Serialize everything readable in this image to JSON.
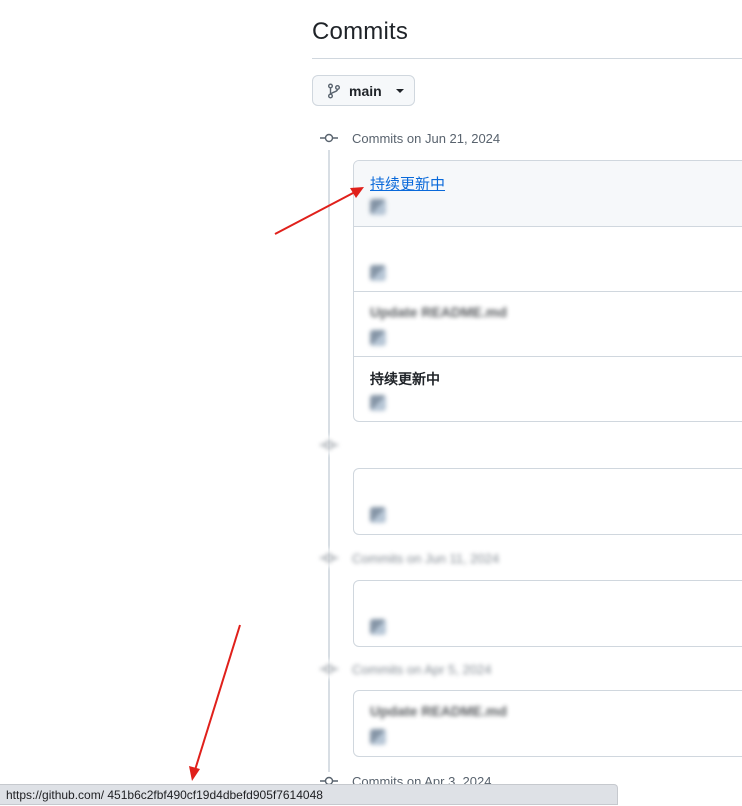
{
  "page": {
    "title": "Commits"
  },
  "branch_selector": {
    "label": "main",
    "icon": "git-branch-icon"
  },
  "groups": [
    {
      "header": "Commits on Jun 21, 2024",
      "commits": [
        {
          "title": "持续更新中",
          "meta": "                        ",
          "highlight": true,
          "link": true
        },
        {
          "title": "        ",
          "meta": "                       "
        },
        {
          "title": "Update README.md",
          "meta": "                      "
        },
        {
          "title": "持续更新中",
          "meta": "                       "
        }
      ]
    },
    {
      "header": "                         ",
      "commits": [
        {
          "title": "        ",
          "meta": "                       "
        }
      ]
    },
    {
      "header": "Commits on Jun 11, 2024",
      "commits": [
        {
          "title": "        ",
          "meta": "                       "
        }
      ]
    },
    {
      "header": "Commits on Apr 5, 2024",
      "commits": [
        {
          "title": "Update README.md",
          "meta": "                       "
        }
      ]
    },
    {
      "header": "Commits on Apr 3, 2024"
    }
  ],
  "status_bar": {
    "url": "https://github.com/                                          451b6c2fbf490cf19d4dbefd905f7614048"
  },
  "colors": {
    "link": "#0969da",
    "border": "#d0d7de",
    "muted_text": "#59636e",
    "annotation_arrow": "#e0201b"
  }
}
